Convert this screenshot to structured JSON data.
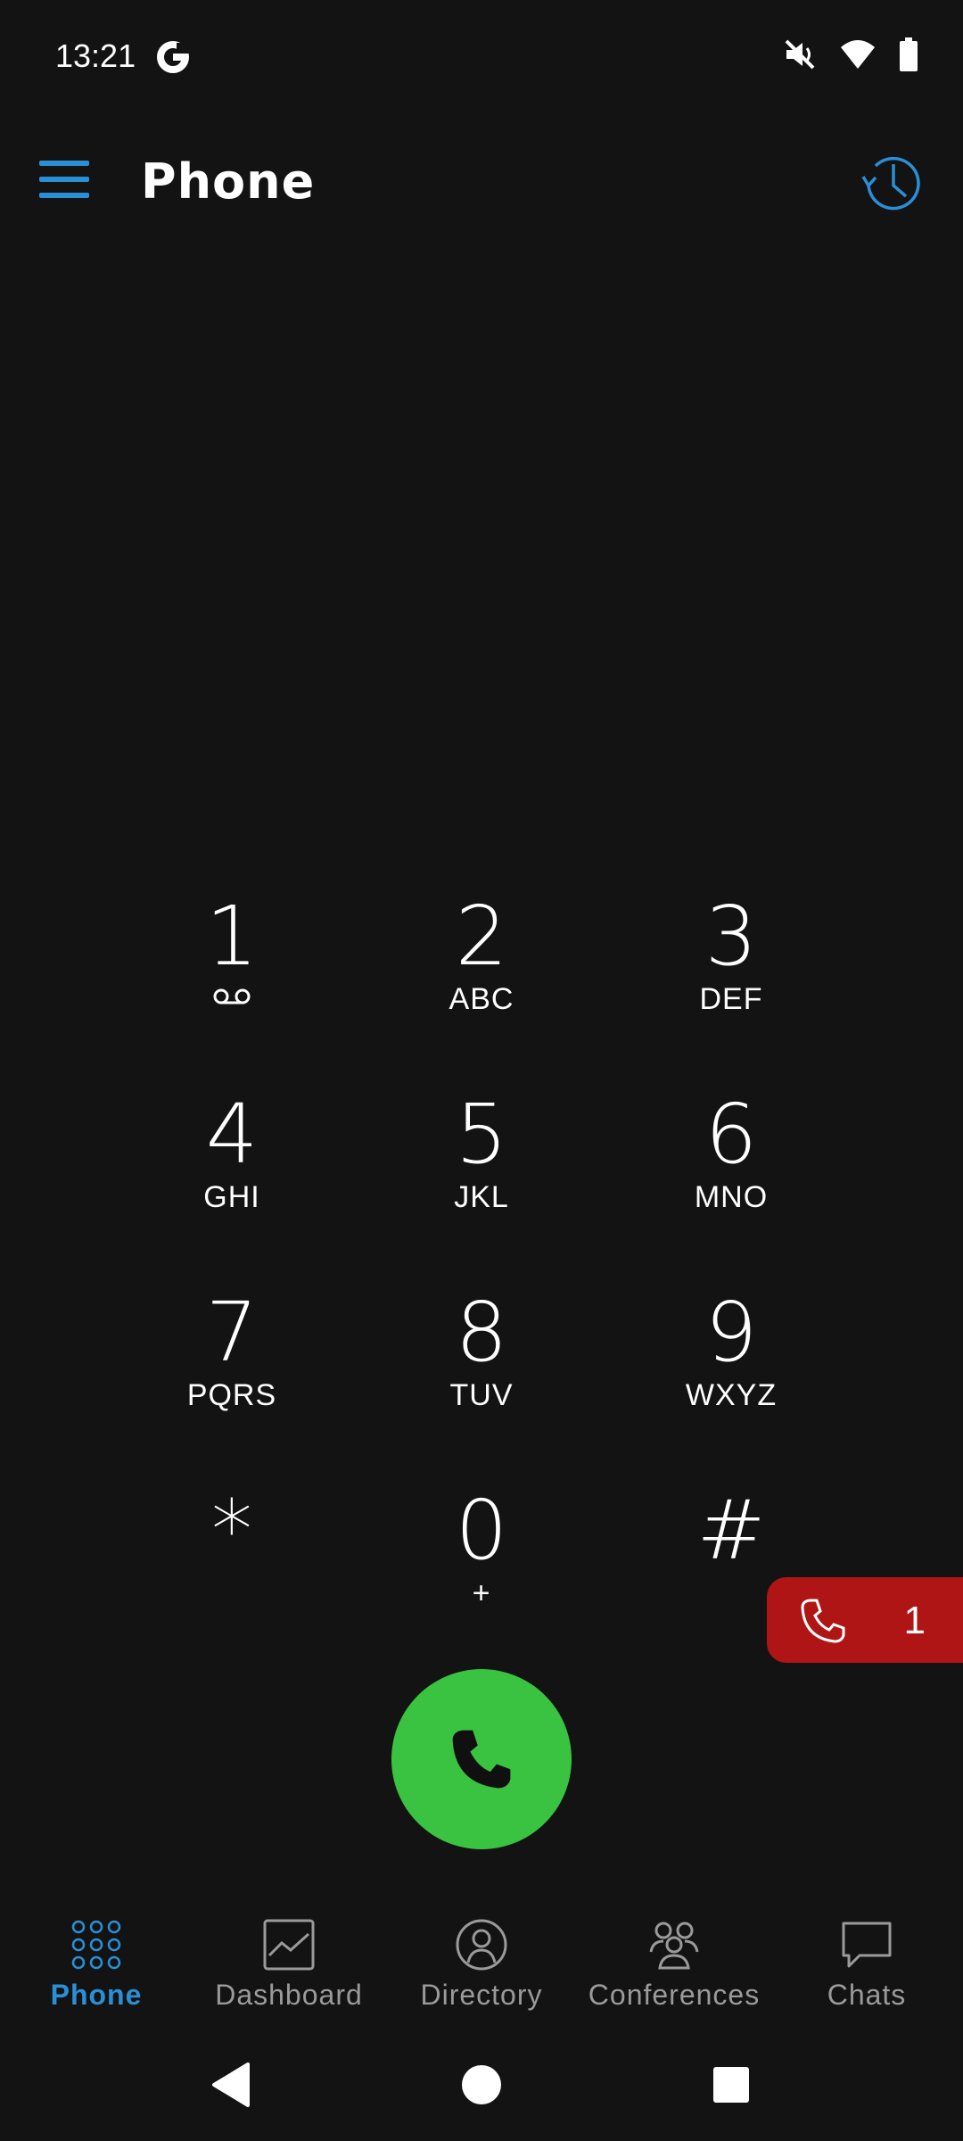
{
  "status_bar": {
    "time": "13:21",
    "icons": [
      "google-g-icon",
      "mute-icon",
      "wifi-icon",
      "battery-icon"
    ]
  },
  "app_bar": {
    "title": "Phone",
    "menu_icon": "hamburger-menu-icon",
    "history_icon": "call-history-icon",
    "accent_color": "#2b8fd6"
  },
  "dialpad": {
    "keys": [
      {
        "digit": "1",
        "letters": ""
      },
      {
        "digit": "2",
        "letters": "ABC"
      },
      {
        "digit": "3",
        "letters": "DEF"
      },
      {
        "digit": "4",
        "letters": "GHI"
      },
      {
        "digit": "5",
        "letters": "JKL"
      },
      {
        "digit": "6",
        "letters": "MNO"
      },
      {
        "digit": "7",
        "letters": "PQRS"
      },
      {
        "digit": "8",
        "letters": "TUV"
      },
      {
        "digit": "9",
        "letters": "WXYZ"
      },
      {
        "digit": "*",
        "letters": ""
      },
      {
        "digit": "0",
        "letters": "+"
      },
      {
        "digit": "#",
        "letters": ""
      }
    ],
    "voicemail_icon": "voicemail-icon"
  },
  "call_button": {
    "icon": "phone-icon",
    "color": "#3ac241"
  },
  "active_calls": {
    "count": "1",
    "icon": "phone-icon",
    "color": "#b01515"
  },
  "bottom_nav": {
    "items": [
      {
        "label": "Phone",
        "icon": "dialpad-icon",
        "active": true
      },
      {
        "label": "Dashboard",
        "icon": "dashboard-chart-icon",
        "active": false
      },
      {
        "label": "Directory",
        "icon": "directory-person-icon",
        "active": false
      },
      {
        "label": "Conferences",
        "icon": "conferences-group-icon",
        "active": false
      },
      {
        "label": "Chats",
        "icon": "chat-bubble-icon",
        "active": false
      }
    ]
  },
  "system_nav": {
    "icons": [
      "back-icon",
      "home-icon",
      "recents-icon"
    ]
  }
}
